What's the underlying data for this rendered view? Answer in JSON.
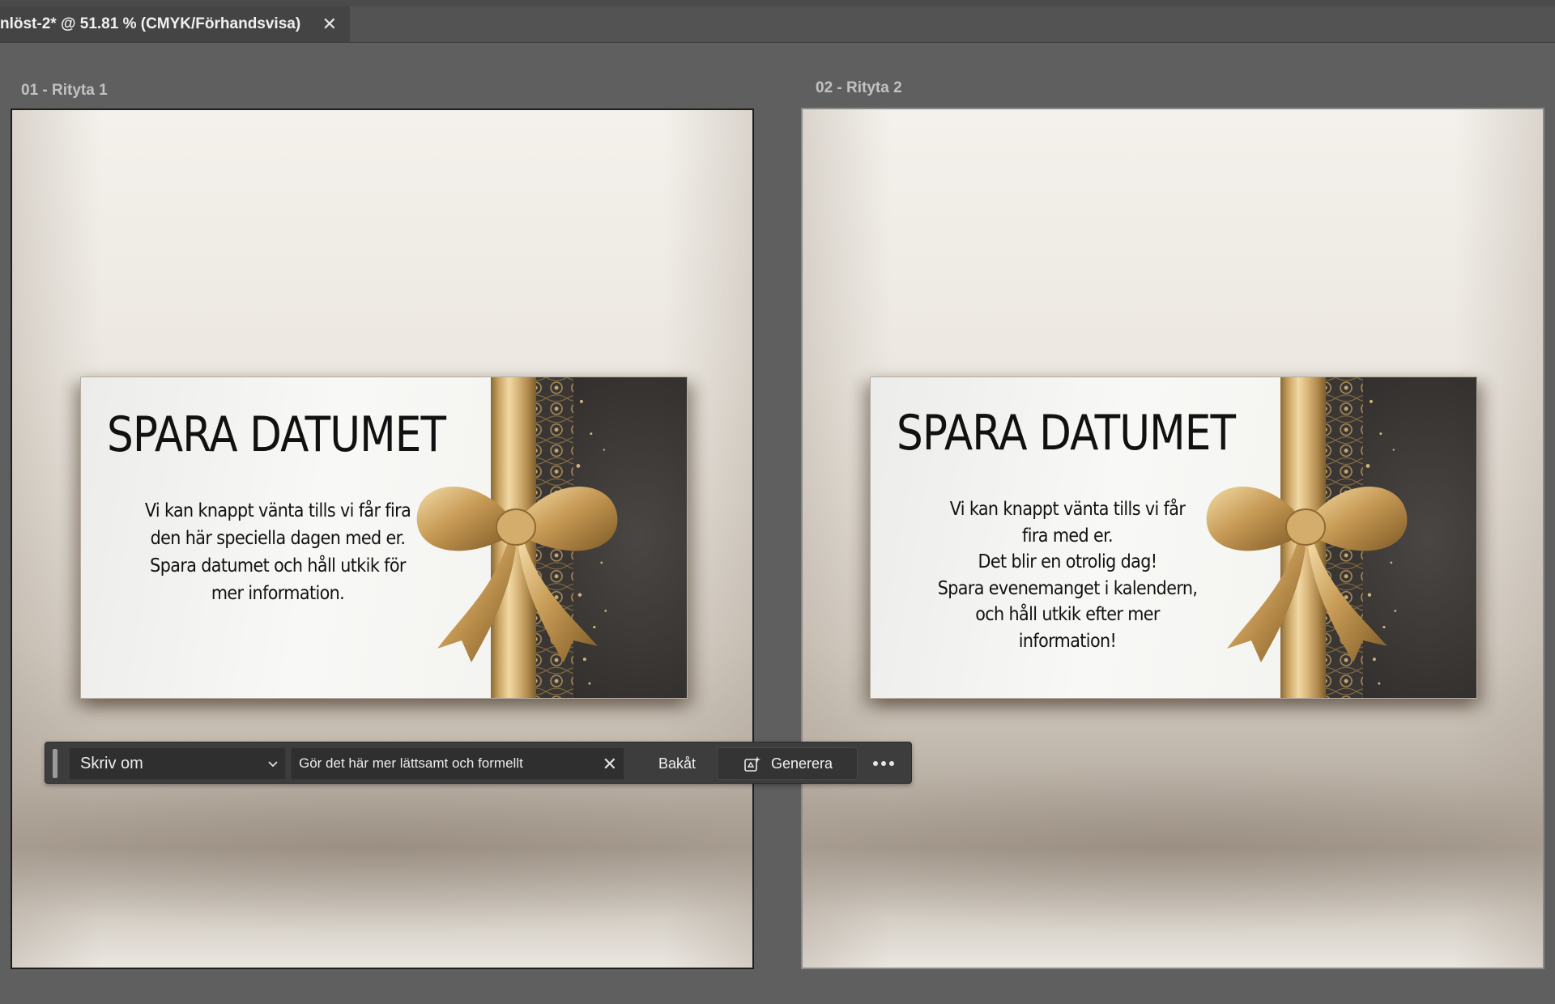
{
  "tab": {
    "title": "nlöst-2* @ 51.81 % (CMYK/Förhandsvisa)",
    "close_glyph": "✕"
  },
  "artboards": [
    {
      "label": "01 - Rityta 1",
      "card": {
        "title": "SPARA DATUMET",
        "body_lines": [
          "Vi kan knappt vänta tills vi får fira",
          "den här speciella dagen med er.",
          "Spara datumet och håll utkik för",
          "mer information."
        ]
      }
    },
    {
      "label": "02 - Rityta 2",
      "card": {
        "title": "SPARA DATUMET",
        "body_lines": [
          "Vi kan knappt vänta tills vi får",
          "fira med er.",
          "Det blir en otrolig dag!",
          "Spara evenemanget i kalendern,",
          "och håll utkik efter mer",
          "information!"
        ]
      }
    }
  ],
  "context_bar": {
    "mode_select": {
      "value": "Skriv om",
      "icon": "chevron-down-icon"
    },
    "prompt_field": {
      "value": "Gör det här mer lättsamt och formellt",
      "clear_glyph": "✕"
    },
    "back_label": "Bakåt",
    "generate_label": "Generera",
    "more_icon": "more-horizontal-icon"
  },
  "colors": {
    "workspace": "#5f5f5f",
    "tab_active": "#444444",
    "toolbar": "#3d3d3d",
    "card_dark_panel": "#383533",
    "ribbon_gold": "#d9b57a"
  }
}
